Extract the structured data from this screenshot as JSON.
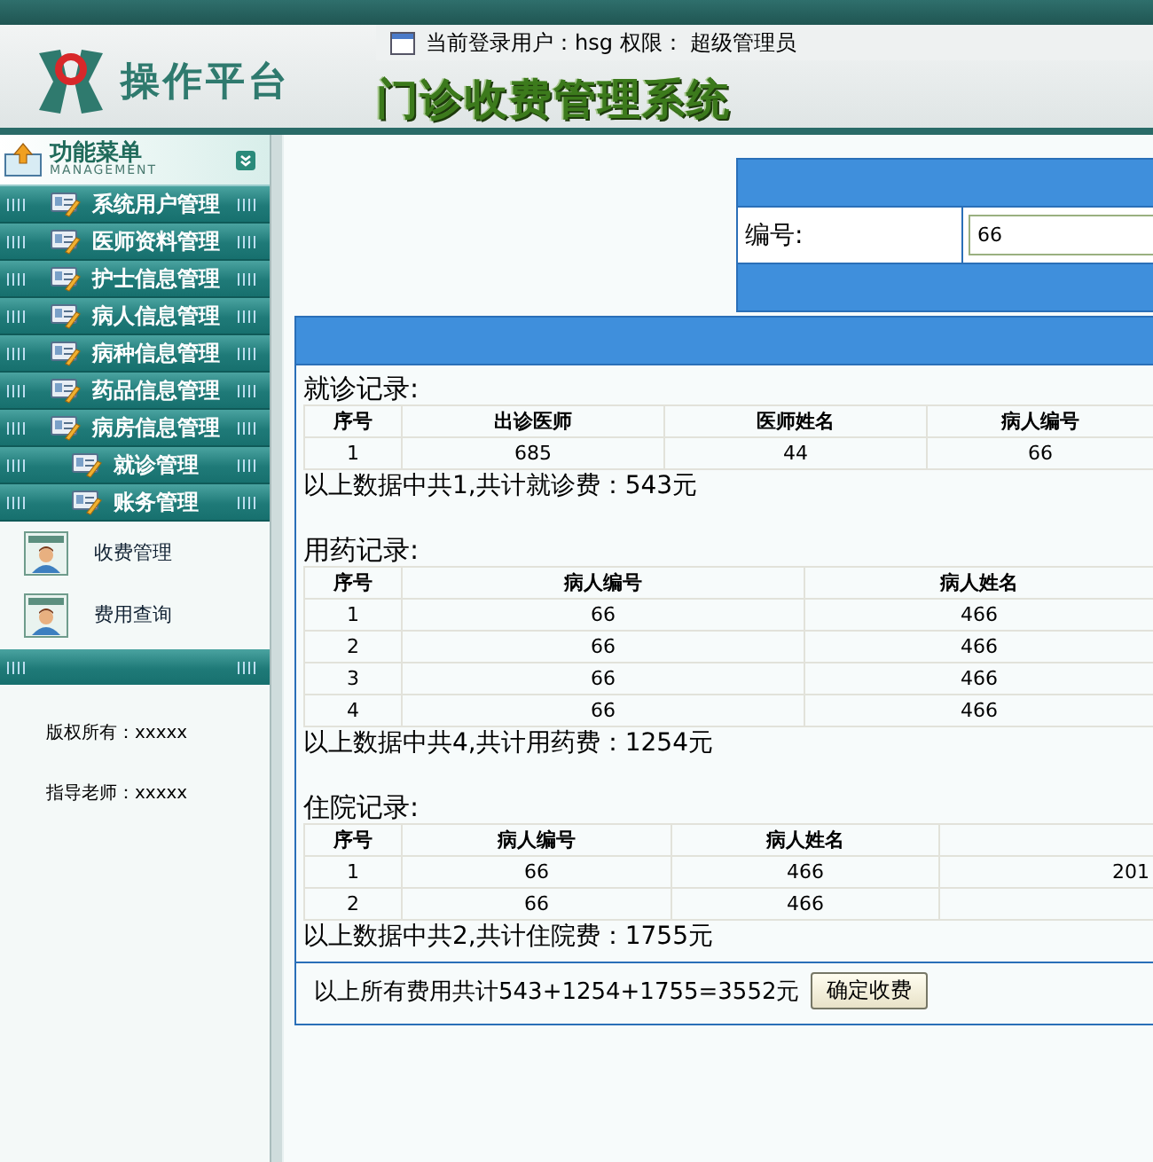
{
  "app": {
    "logo_text": "操作平台",
    "system_title": "门诊收费管理系统",
    "login_info": "当前登录用户：hsg 权限： 超级管理员"
  },
  "sidebar": {
    "title": "功能菜单",
    "subtitle": "MANAGEMENT",
    "items": [
      {
        "label": "系统用户管理"
      },
      {
        "label": "医师资料管理"
      },
      {
        "label": "护士信息管理"
      },
      {
        "label": "病人信息管理"
      },
      {
        "label": "病种信息管理"
      },
      {
        "label": "药品信息管理"
      },
      {
        "label": "病房信息管理"
      },
      {
        "label": "就诊管理"
      },
      {
        "label": "账务管理",
        "children": [
          {
            "label": "收费管理"
          },
          {
            "label": "费用查询"
          }
        ]
      }
    ],
    "footer": [
      "版权所有：xxxxx",
      "指导老师：xxxxx"
    ]
  },
  "search": {
    "label": "编号:",
    "value": "66"
  },
  "sections": [
    {
      "title": "就诊记录:",
      "columns": [
        "序号",
        "出诊医师",
        "医师姓名",
        "病人编号"
      ],
      "rows": [
        [
          "1",
          "685",
          "44",
          "66"
        ]
      ],
      "summary": "以上数据中共1,共计就诊费：543元"
    },
    {
      "title": "用药记录:",
      "columns": [
        "序号",
        "病人编号",
        "病人姓名"
      ],
      "rows": [
        [
          "1",
          "66",
          "466"
        ],
        [
          "2",
          "66",
          "466"
        ],
        [
          "3",
          "66",
          "466"
        ],
        [
          "4",
          "66",
          "466"
        ]
      ],
      "summary": "以上数据中共4,共计用药费：1254元"
    },
    {
      "title": "住院记录:",
      "columns": [
        "序号",
        "病人编号",
        "病人姓名"
      ],
      "rows": [
        [
          "1",
          "66",
          "466",
          "201"
        ],
        [
          "2",
          "66",
          "466",
          ""
        ]
      ],
      "summary": "以上数据中共2,共计住院费：1755元"
    }
  ],
  "total": {
    "text": "以上所有费用共计543+1254+1755=3552元",
    "button": "确定收费"
  }
}
